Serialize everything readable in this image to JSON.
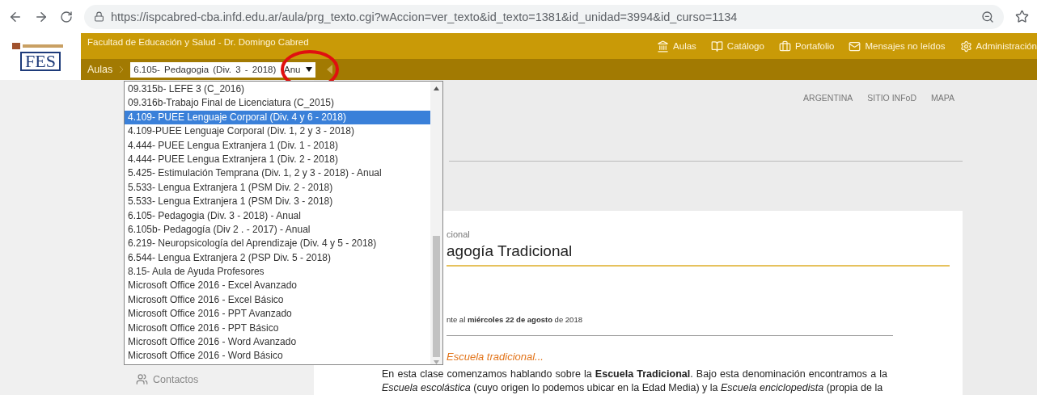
{
  "browser": {
    "url": "https://ispcabred-cba.infd.edu.ar/aula/prg_texto.cgi?wAccion=ver_texto&id_texto=1381&id_unidad=3994&id_curso=1134"
  },
  "header": {
    "logo_text": "FES",
    "institution": "Facultad de Educación y Salud - Dr. Domingo Cabred",
    "nav": [
      {
        "label": "Aulas",
        "kind": "classroom"
      },
      {
        "label": "Catálogo",
        "kind": "catalog"
      },
      {
        "label": "Portafolio",
        "kind": "portfolio"
      },
      {
        "label": "Mensajes no leídos",
        "kind": "messages"
      },
      {
        "label": "Administración",
        "kind": "admin"
      }
    ]
  },
  "breadcrumb": {
    "root": "Aulas",
    "select_value": "6.105- Pedagogia (Div. 3 - 2018)  Anu"
  },
  "dropdown": {
    "options": [
      {
        "label": "09.315b- LEFE 3 (C_2016)",
        "selected": false
      },
      {
        "label": "09.316b-Trabajo Final de Licenciatura (C_2015)",
        "selected": false
      },
      {
        "label": "4.109- PUEE Lenguaje Corporal (Div. 4 y 6 - 2018)",
        "selected": true
      },
      {
        "label": "4.109-PUEE Lenguaje Corporal (Div. 1, 2 y 3 - 2018)",
        "selected": false
      },
      {
        "label": "4.444- PUEE Lengua Extranjera 1 (Div. 1 - 2018)",
        "selected": false
      },
      {
        "label": "4.444- PUEE Lengua Extranjera 1 (Div. 2 - 2018)",
        "selected": false
      },
      {
        "label": "5.425- Estimulación Temprana (Div. 1, 2 y 3 - 2018) - Anual",
        "selected": false
      },
      {
        "label": "5.533- Lengua Extranjera 1 (PSM Div. 2 - 2018)",
        "selected": false
      },
      {
        "label": "5.533- Lengua Extranjera 1 (PSM Div. 3 - 2018)",
        "selected": false
      },
      {
        "label": "6.105- Pedagogia (Div. 3 - 2018) - Anual",
        "selected": false
      },
      {
        "label": "6.105b- Pedagogía (Div 2 . - 2017) - Anual",
        "selected": false
      },
      {
        "label": "6.219- Neuropsicología del Aprendizaje (Div. 4 y 5 - 2018)",
        "selected": false
      },
      {
        "label": "6.544- Lengua Extranjera 2 (PSP Div. 5 - 2018)",
        "selected": false
      },
      {
        "label": "8.15- Aula de Ayuda Profesores",
        "selected": false
      },
      {
        "label": "Microsoft Office 2016 - Excel Avanzado",
        "selected": false
      },
      {
        "label": "Microsoft Office 2016 - Excel Básico",
        "selected": false
      },
      {
        "label": "Microsoft Office 2016 - PPT Avanzado",
        "selected": false
      },
      {
        "label": "Microsoft Office 2016 - PPT Básico",
        "selected": false
      },
      {
        "label": "Microsoft Office 2016 - Word Avanzado",
        "selected": false
      },
      {
        "label": "Microsoft Office 2016 - Word Básico",
        "selected": false
      }
    ]
  },
  "top_links": [
    "ARGENTINA",
    "SITIO INFoD",
    "MAPA"
  ],
  "sidebar": {
    "items": [
      {
        "label": "Contactos"
      }
    ]
  },
  "article": {
    "section": "cional",
    "title": "agogía Tradicional",
    "date": "nte al **miércoles 22 de agosto** de 2018",
    "subtitle": "Escuela tradicional...",
    "paragraph": "En esta clase comenzamos hablando sobre la **Escuela Tradicional**. Bajo esta denominación encontramos a la *Escuela escolástica* (cuyo origen lo podemos ubicar en la Edad Media) y la *Escuela enciclopedista* (propia de la"
  }
}
